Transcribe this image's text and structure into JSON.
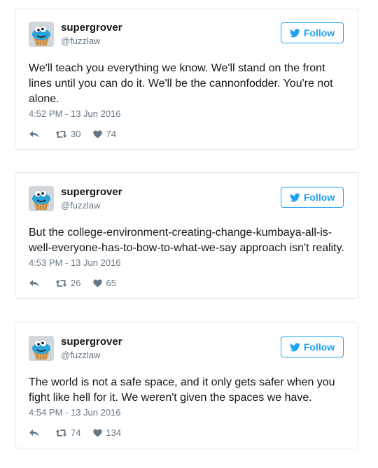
{
  "colors": {
    "accent": "#1da1f2",
    "text": "#14171a",
    "muted": "#657786",
    "border": "#e1e8ed"
  },
  "tweets": [
    {
      "name": "supergrover",
      "handle": "@fuzzlaw",
      "follow_label": "Follow",
      "text": "We'll teach you everything we know. We'll stand on the front lines until you can do it. We'll be the cannonfodder. You're not alone.",
      "timestamp": "4:52 PM - 13 Jun 2016",
      "retweets": "30",
      "likes": "74"
    },
    {
      "name": "supergrover",
      "handle": "@fuzzlaw",
      "follow_label": "Follow",
      "text": "But the college-environment-creating-change-kumbaya-all-is-well-everyone-has-to-bow-to-what-we-say approach isn't reality.",
      "timestamp": "4:53 PM - 13 Jun 2016",
      "retweets": "26",
      "likes": "65"
    },
    {
      "name": "supergrover",
      "handle": "@fuzzlaw",
      "follow_label": "Follow",
      "text": "The world is not a safe space, and it only gets safer when you fight like hell for it. We weren't given the spaces we have.",
      "timestamp": "4:54 PM - 13 Jun 2016",
      "retweets": "74",
      "likes": "134"
    }
  ],
  "icons": {
    "avatar": "cookie-monster-cupcake-icon",
    "follow": "twitter-bird-icon",
    "reply": "reply-icon",
    "retweet": "retweet-icon",
    "like": "heart-icon"
  }
}
